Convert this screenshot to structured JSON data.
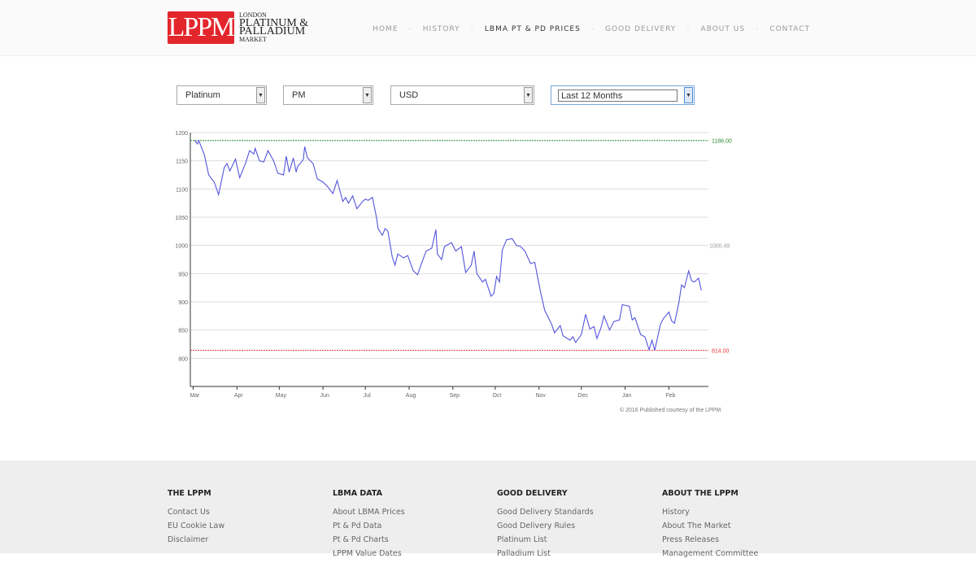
{
  "header": {
    "logo": {
      "mark": "LPPM",
      "line1": "LONDON",
      "line2": "PLATINUM &",
      "line3": "PALLADIUM",
      "line4": "MARKET"
    },
    "nav": [
      {
        "label": "HOME"
      },
      {
        "label": "HISTORY"
      },
      {
        "label": "LBMA PT & PD PRICES",
        "active": true
      },
      {
        "label": "GOOD DELIVERY"
      },
      {
        "label": "ABOUT US"
      },
      {
        "label": "CONTACT"
      }
    ]
  },
  "filters": {
    "metal": "Platinum",
    "fixing": "PM",
    "currency": "USD",
    "period": "Last 12 Months"
  },
  "chart_data": {
    "type": "line",
    "ylim": [
      750,
      1200
    ],
    "yticks": [
      800,
      850,
      900,
      950,
      1000,
      1050,
      1100,
      1150,
      1200
    ],
    "xticks": [
      "Mar",
      "Apr",
      "May",
      "Jun",
      "Jul",
      "Aug",
      "Sep",
      "Oct",
      "Nov",
      "Dec",
      "Jan",
      "Feb"
    ],
    "xlim": [
      "2015-02-27",
      "2016-02-29"
    ],
    "reference_lines": [
      {
        "label": "1186.00",
        "value": 1186,
        "color": "#2e8b2e"
      },
      {
        "label": "814.00",
        "value": 814,
        "color": "#e53935"
      },
      {
        "label": "1000.49",
        "value": 1000.49,
        "color": "#999999"
      }
    ],
    "line_color": "#5555dd",
    "grid": true,
    "points": [
      [
        "2015-03-02",
        1186
      ],
      [
        "2015-03-04",
        1180
      ],
      [
        "2015-03-05",
        1186
      ],
      [
        "2015-03-09",
        1160
      ],
      [
        "2015-03-12",
        1125
      ],
      [
        "2015-03-16",
        1112
      ],
      [
        "2015-03-19",
        1090
      ],
      [
        "2015-03-23",
        1138
      ],
      [
        "2015-03-25",
        1145
      ],
      [
        "2015-03-27",
        1132
      ],
      [
        "2015-03-31",
        1153
      ],
      [
        "2015-04-03",
        1120
      ],
      [
        "2015-04-07",
        1145
      ],
      [
        "2015-04-10",
        1168
      ],
      [
        "2015-04-13",
        1162
      ],
      [
        "2015-04-14",
        1172
      ],
      [
        "2015-04-17",
        1150
      ],
      [
        "2015-04-20",
        1148
      ],
      [
        "2015-04-23",
        1168
      ],
      [
        "2015-04-27",
        1150
      ],
      [
        "2015-04-30",
        1128
      ],
      [
        "2015-05-04",
        1125
      ],
      [
        "2015-05-06",
        1158
      ],
      [
        "2015-05-08",
        1130
      ],
      [
        "2015-05-11",
        1155
      ],
      [
        "2015-05-13",
        1130
      ],
      [
        "2015-05-14",
        1140
      ],
      [
        "2015-05-18",
        1152
      ],
      [
        "2015-05-19",
        1175
      ],
      [
        "2015-05-21",
        1155
      ],
      [
        "2015-05-25",
        1145
      ],
      [
        "2015-05-28",
        1118
      ],
      [
        "2015-06-01",
        1112
      ],
      [
        "2015-06-04",
        1105
      ],
      [
        "2015-06-08",
        1092
      ],
      [
        "2015-06-11",
        1115
      ],
      [
        "2015-06-15",
        1078
      ],
      [
        "2015-06-17",
        1085
      ],
      [
        "2015-06-19",
        1075
      ],
      [
        "2015-06-22",
        1088
      ],
      [
        "2015-06-25",
        1065
      ],
      [
        "2015-06-29",
        1078
      ],
      [
        "2015-07-01",
        1082
      ],
      [
        "2015-07-03",
        1080
      ],
      [
        "2015-07-06",
        1085
      ],
      [
        "2015-07-09",
        1048
      ],
      [
        "2015-07-10",
        1030
      ],
      [
        "2015-07-13",
        1018
      ],
      [
        "2015-07-15",
        1030
      ],
      [
        "2015-07-17",
        1025
      ],
      [
        "2015-07-20",
        980
      ],
      [
        "2015-07-22",
        965
      ],
      [
        "2015-07-24",
        985
      ],
      [
        "2015-07-28",
        978
      ],
      [
        "2015-07-31",
        982
      ],
      [
        "2015-08-04",
        955
      ],
      [
        "2015-08-07",
        948
      ],
      [
        "2015-08-10",
        970
      ],
      [
        "2015-08-13",
        990
      ],
      [
        "2015-08-17",
        995
      ],
      [
        "2015-08-20",
        1028
      ],
      [
        "2015-08-21",
        985
      ],
      [
        "2015-08-24",
        975
      ],
      [
        "2015-08-26",
        998
      ],
      [
        "2015-08-31",
        1005
      ],
      [
        "2015-09-03",
        990
      ],
      [
        "2015-09-07",
        998
      ],
      [
        "2015-09-10",
        952
      ],
      [
        "2015-09-14",
        965
      ],
      [
        "2015-09-16",
        990
      ],
      [
        "2015-09-18",
        950
      ],
      [
        "2015-09-22",
        935
      ],
      [
        "2015-09-24",
        940
      ],
      [
        "2015-09-28",
        910
      ],
      [
        "2015-09-30",
        915
      ],
      [
        "2015-10-02",
        945
      ],
      [
        "2015-10-04",
        935
      ],
      [
        "2015-10-06",
        992
      ],
      [
        "2015-10-09",
        1010
      ],
      [
        "2015-10-13",
        1012
      ],
      [
        "2015-10-16",
        1000
      ],
      [
        "2015-10-19",
        998
      ],
      [
        "2015-10-22",
        990
      ],
      [
        "2015-10-26",
        968
      ],
      [
        "2015-10-29",
        970
      ],
      [
        "2015-11-02",
        918
      ],
      [
        "2015-11-05",
        885
      ],
      [
        "2015-11-10",
        860
      ],
      [
        "2015-11-12",
        845
      ],
      [
        "2015-11-16",
        858
      ],
      [
        "2015-11-18",
        840
      ],
      [
        "2015-11-23",
        832
      ],
      [
        "2015-11-25",
        838
      ],
      [
        "2015-11-27",
        828
      ],
      [
        "2015-12-01",
        842
      ],
      [
        "2015-12-04",
        878
      ],
      [
        "2015-12-07",
        852
      ],
      [
        "2015-12-10",
        856
      ],
      [
        "2015-12-12",
        835
      ],
      [
        "2015-12-15",
        855
      ],
      [
        "2015-12-17",
        875
      ],
      [
        "2015-12-21",
        850
      ],
      [
        "2015-12-24",
        865
      ],
      [
        "2015-12-28",
        868
      ],
      [
        "2015-12-30",
        895
      ],
      [
        "2016-01-04",
        892
      ],
      [
        "2016-01-06",
        868
      ],
      [
        "2016-01-08",
        872
      ],
      [
        "2016-01-12",
        842
      ],
      [
        "2016-01-15",
        838
      ],
      [
        "2016-01-18",
        815
      ],
      [
        "2016-01-20",
        832
      ],
      [
        "2016-01-22",
        814
      ],
      [
        "2016-01-26",
        860
      ],
      [
        "2016-01-28",
        870
      ],
      [
        "2016-02-01",
        882
      ],
      [
        "2016-02-03",
        866
      ],
      [
        "2016-02-05",
        862
      ],
      [
        "2016-02-08",
        898
      ],
      [
        "2016-02-10",
        930
      ],
      [
        "2016-02-12",
        925
      ],
      [
        "2016-02-15",
        955
      ],
      [
        "2016-02-17",
        938
      ],
      [
        "2016-02-19",
        935
      ],
      [
        "2016-02-22",
        942
      ],
      [
        "2016-02-24",
        920
      ]
    ]
  },
  "copyright": "© 2016 Published courtesy of the LPPM",
  "footer": {
    "columns": [
      {
        "title": "THE LPPM",
        "links": [
          "Contact Us",
          "EU Cookie Law",
          "Disclaimer"
        ]
      },
      {
        "title": "LBMA DATA",
        "links": [
          "About LBMA Prices",
          "Pt & Pd Data",
          "Pt & Pd Charts",
          "LPPM Value Dates"
        ]
      },
      {
        "title": "GOOD DELIVERY",
        "links": [
          "Good Delivery Standards",
          "Good Delivery Rules",
          "Platinum List",
          "Palladium List"
        ]
      },
      {
        "title": "ABOUT THE LPPM",
        "links": [
          "History",
          "About The Market",
          "Press Releases",
          "Management Committee"
        ]
      }
    ]
  }
}
